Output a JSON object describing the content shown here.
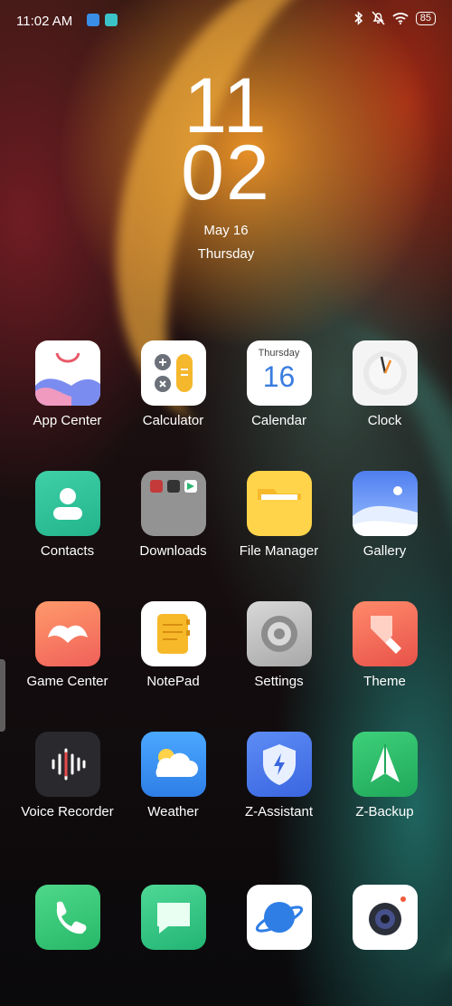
{
  "status_bar": {
    "time": "11:02 AM",
    "battery": "85",
    "icons": [
      "app-notification-icon",
      "calendar-notification-icon",
      "bluetooth-icon",
      "muted-bell-icon",
      "wifi-icon",
      "battery-icon"
    ]
  },
  "clock": {
    "hour": "11",
    "minute": "02",
    "date": "May 16",
    "weekday": "Thursday"
  },
  "apps": [
    {
      "label": "App Center",
      "icon": "app-center-icon"
    },
    {
      "label": "Calculator",
      "icon": "calculator-icon"
    },
    {
      "label": "Calendar",
      "icon": "calendar-icon",
      "weekday": "Thursday",
      "day": "16"
    },
    {
      "label": "Clock",
      "icon": "clock-icon"
    },
    {
      "label": "Contacts",
      "icon": "contacts-icon"
    },
    {
      "label": "Downloads",
      "icon": "folder-icon"
    },
    {
      "label": "File Manager",
      "icon": "file-manager-icon"
    },
    {
      "label": "Gallery",
      "icon": "gallery-icon"
    },
    {
      "label": "Game Center",
      "icon": "game-center-icon"
    },
    {
      "label": "NotePad",
      "icon": "notepad-icon"
    },
    {
      "label": "Settings",
      "icon": "settings-gear-icon"
    },
    {
      "label": "Theme",
      "icon": "theme-brush-icon"
    },
    {
      "label": "Voice Recorder",
      "icon": "voice-recorder-icon"
    },
    {
      "label": "Weather",
      "icon": "weather-cloud-icon"
    },
    {
      "label": "Z-Assistant",
      "icon": "shield-bolt-icon"
    },
    {
      "label": "Z-Backup",
      "icon": "z-backup-icon"
    }
  ],
  "dock": [
    {
      "icon": "phone-icon"
    },
    {
      "icon": "messages-icon"
    },
    {
      "icon": "browser-planet-icon"
    },
    {
      "icon": "camera-icon"
    }
  ]
}
